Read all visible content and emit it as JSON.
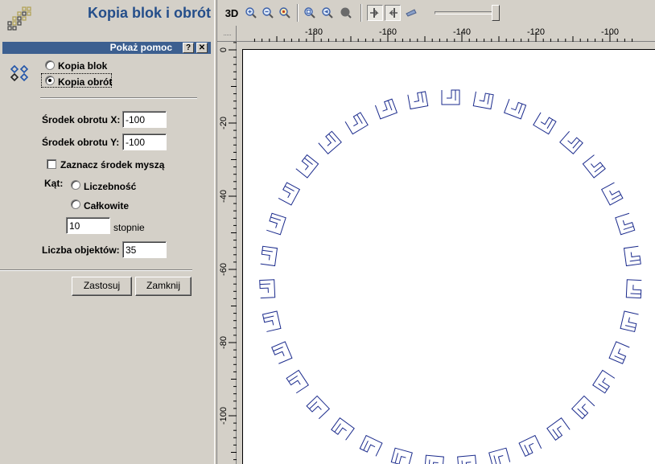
{
  "panel": {
    "title": "Kopia blok i obrót",
    "help_label": "Pokaż pomoc",
    "help_button": "?",
    "close_button": "✕"
  },
  "mode": {
    "option_block": "Kopia blok",
    "option_rotate": "Kopia obrót",
    "selected": "Kopia obrót"
  },
  "form": {
    "center_x_label": "Środek obrotu X:",
    "center_x_value": "-100",
    "center_y_label": "Środek obrotu Y:",
    "center_y_value": "-100",
    "mark_center_label": "Zaznacz środek myszą",
    "mark_center_checked": false,
    "angle_label": "Kąt:",
    "angle_opt_count": "Liczebność",
    "angle_opt_total": "Całkowite",
    "angle_value": "10",
    "angle_unit": "stopnie",
    "objects_label": "Liczba objektów:",
    "objects_value": "35"
  },
  "buttons": {
    "apply": "Zastosuj",
    "close": "Zamknij"
  },
  "toolbar": {
    "view_3d": "3D",
    "icons": [
      "zoom-in-icon",
      "zoom-out-icon",
      "zoom-fit-icon",
      "zoom-window-icon",
      "zoom-previous-icon",
      "pan-icon",
      "snap-icon",
      "grid-icon",
      "measure-icon"
    ],
    "zoom_slider_level": 0.95
  },
  "rulers": {
    "top_labels": [
      "-180",
      "-160",
      "-140",
      "-120",
      "-100"
    ],
    "left_labels": [
      "0",
      "-20",
      "-40",
      "-60",
      "-80",
      "-100"
    ]
  },
  "drawing": {
    "copies": 35,
    "angle_step_deg": 10,
    "stroke_color": "#1a2a8c"
  },
  "colors": {
    "title": "#244e8a",
    "help_bar": "#3c5f90",
    "background": "#d4d0c8"
  }
}
